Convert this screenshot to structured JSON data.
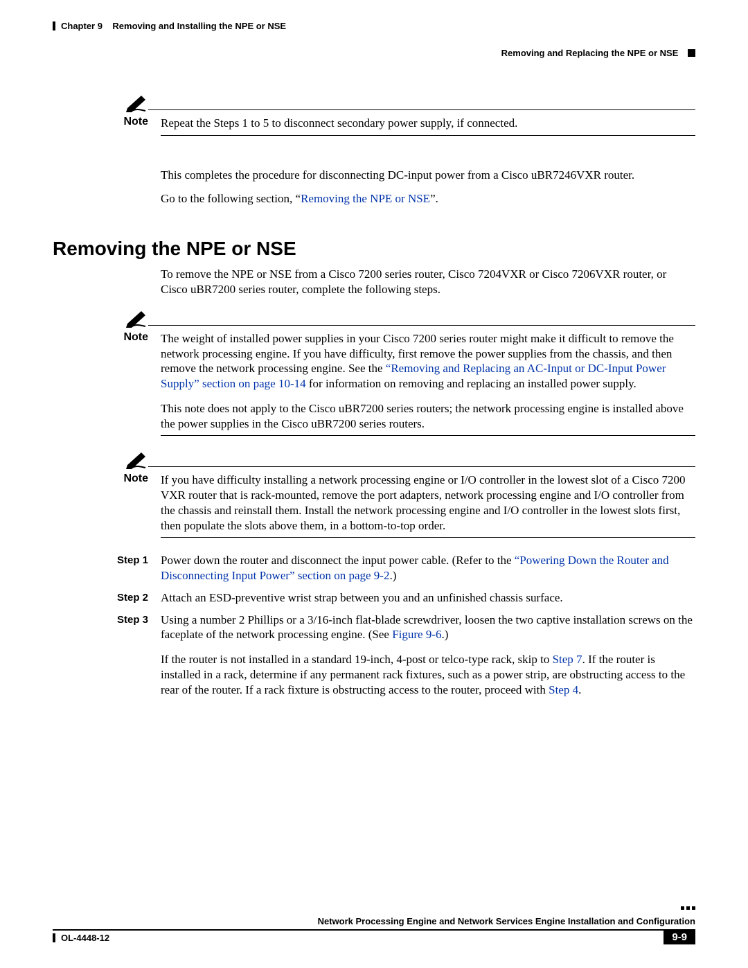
{
  "header": {
    "chapter_label": "Chapter 9",
    "chapter_title": "Removing and Installing the NPE or NSE",
    "right_section": "Removing and Replacing the NPE or NSE"
  },
  "note1": {
    "label": "Note",
    "text": "Repeat the Steps 1 to 5 to disconnect secondary power supply, if connected."
  },
  "para_dc_done": {
    "text": "This completes the procedure for disconnecting DC-input power from a Cisco uBR7246VXR router."
  },
  "para_goto": {
    "prefix": "Go to the following section, ",
    "link": "Removing the NPE or NSE",
    "suffix": "."
  },
  "section_heading": "Removing the NPE or NSE",
  "para_intro": "To remove the NPE or NSE from a Cisco 7200 series router, Cisco 7204VXR or Cisco 7206VXR router, or Cisco uBR7200 series router, complete the following steps.",
  "note2": {
    "label": "Note",
    "p1_before": "The weight of installed power supplies in your Cisco 7200 series router might make it difficult to remove the network processing engine. If you have difficulty, first remove the power supplies from the chassis, and then remove the network processing engine. See the ",
    "p1_link": "“Removing and Replacing an AC-Input or DC-Input Power Supply” section on page 10-14",
    "p1_after": " for information on removing and replacing an installed power supply.",
    "p2": "This note does not apply to the Cisco uBR7200 series routers; the network processing engine is installed above the power supplies in the Cisco uBR7200 series routers."
  },
  "note3": {
    "label": "Note",
    "text": "If you have difficulty installing a network processing engine or I/O controller in the lowest slot of  a Cisco 7200 VXR  router that is rack-mounted, remove the port adapters, network processing engine and I/O controller from the chassis and reinstall them.  Install the network processing engine  and I/O controller in the lowest slots first, then populate the slots above them, in a bottom-to-top order."
  },
  "steps": {
    "s1": {
      "label": "Step 1",
      "before": "Power down the router and disconnect the input power cable. (Refer to the ",
      "link": "“Powering Down the Router and Disconnecting Input Power” section on page 9-2",
      "after": ".)"
    },
    "s2": {
      "label": "Step 2",
      "text": "Attach an ESD-preventive wrist strap between you and an unfinished chassis surface."
    },
    "s3": {
      "label": "Step 3",
      "before": "Using a number 2 Phillips or a 3/16-inch flat-blade screwdriver, loosen the two captive installation screws on the faceplate of the network processing engine. (See ",
      "link": "Figure 9-6",
      "after": ".)"
    },
    "skip": {
      "before": "If the router is not installed in a standard 19-inch, 4-post or telco-type rack, skip to ",
      "link1": "Step 7",
      "mid": ". If the router is installed in a rack, determine if any permanent rack fixtures, such as a power strip, are obstructing access to the rear of the router. If a rack fixture is obstructing access to the router, proceed with ",
      "link2": "Step 4",
      "after": "."
    }
  },
  "footer": {
    "book_title": "Network Processing Engine and Network Services Engine Installation and Configuration",
    "doc_id": "OL-4448-12",
    "page_num": "9-9"
  }
}
